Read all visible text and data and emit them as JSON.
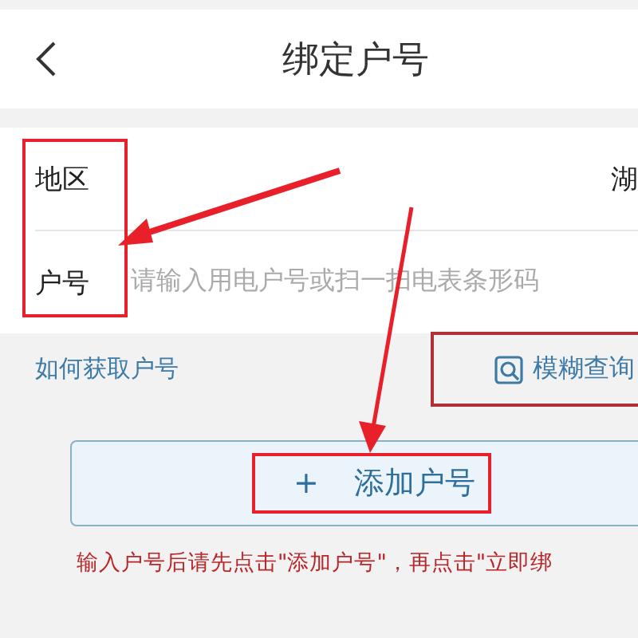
{
  "header": {
    "title": "绑定户号"
  },
  "form": {
    "rows": [
      {
        "kind": "value",
        "label": "地区",
        "value": "湖"
      },
      {
        "kind": "input",
        "label": "户号",
        "placeholder": "请输入用电户号或扫一扫电表条形码"
      }
    ]
  },
  "help_link": "如何获取户号",
  "fuzzy_search": "模糊查询",
  "add_button": {
    "icon": "+",
    "label": "添加户号"
  },
  "note": "输入户号后请先点击\"添加户号\"，再点击\"立即绑"
}
